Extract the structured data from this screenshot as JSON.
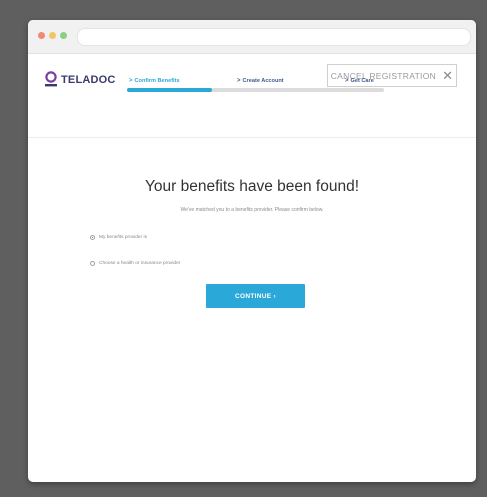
{
  "brand": {
    "name": "TELADOC",
    "color": "#3a3a6b",
    "accent": "#7b3fa0"
  },
  "header": {
    "cancel_label": "CANCEL REGISTRATION",
    "cancel_icon": "close-icon"
  },
  "steps": [
    {
      "label": "Confirm Benefits",
      "active": true
    },
    {
      "label": "Create Account",
      "active": false
    },
    {
      "label": "Get Care",
      "active": false
    }
  ],
  "progress": {
    "fraction": 0.33,
    "color": "#2aa8d8"
  },
  "main": {
    "title": "Your benefits have been found!",
    "subtitle": "We've matched you to a benefits provider. Please confirm below."
  },
  "options": [
    {
      "label": "My benefits provider is",
      "checked": true
    },
    {
      "label": "Choose a health or insurance provider",
      "checked": false
    }
  ],
  "continue_label": "CONTINUE ›"
}
